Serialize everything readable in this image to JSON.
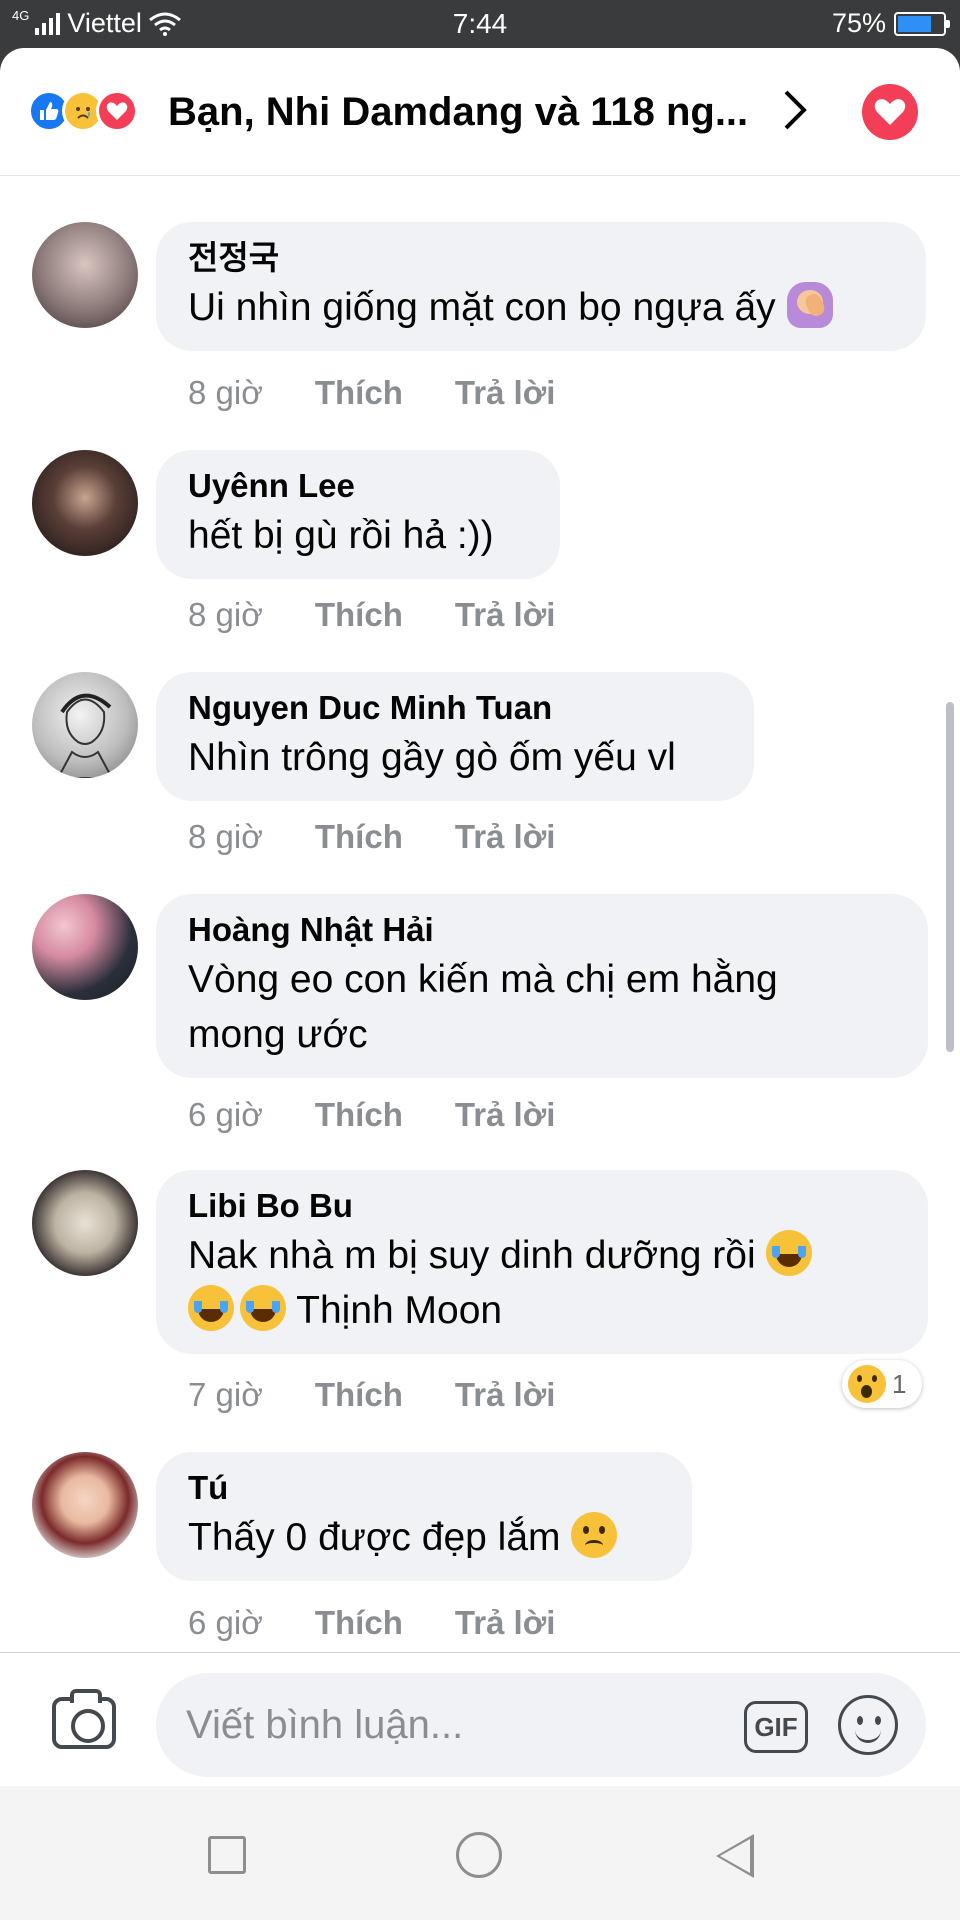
{
  "status_bar": {
    "network": "4G",
    "carrier": "Viettel",
    "time": "7:44",
    "battery_percent": "75%",
    "battery_level": 0.75
  },
  "header": {
    "reaction_icons": [
      "like-icon",
      "sad-icon",
      "love-icon"
    ],
    "title": "Bạn, Nhi Damdang và 118 ng...",
    "chevron": "›",
    "love_button_icon": "heart-icon"
  },
  "comments": [
    {
      "name": "전정국",
      "text": "Ui nhìn giống mặt con bọ ngựa ấy",
      "emoji": "facepalm",
      "time": "8 giờ",
      "like": "Thích",
      "reply": "Trả lời",
      "avatar_color": "#8c7a7a"
    },
    {
      "name": "Uyênn Lee",
      "text": "hết bị gù rồi hả :))",
      "time": "8 giờ",
      "like": "Thích",
      "reply": "Trả lời",
      "avatar_color": "#2b2424"
    },
    {
      "name": "Nguyen Duc Minh Tuan",
      "text": "Nhìn trông gầy gò ốm yếu vl",
      "time": "8 giờ",
      "like": "Thích",
      "reply": "Trả lời",
      "avatar_color": "#c8c8c8"
    },
    {
      "name": "Hoàng Nhật Hải",
      "text_line1": "Vòng eo con kiến mà chị em hằng",
      "text_line2": "mong ước",
      "time": "6 giờ",
      "like": "Thích",
      "reply": "Trả lời",
      "avatar_color": "#4a5a78"
    },
    {
      "name": "Libi Bo Bu",
      "text_line1": "Nak nhà m bị suy dinh dưỡng rồi",
      "mention": "Thịnh Moon",
      "time": "7 giờ",
      "like": "Thích",
      "reply": "Trả lời",
      "reaction_icon": "wow-icon",
      "reaction_count": "1",
      "avatar_color": "#3a3232"
    },
    {
      "name": "Tú",
      "text": "Thấy 0 được đẹp lắm",
      "time": "6 giờ",
      "like": "Thích",
      "reply": "Trả lời",
      "avatar_color": "#7a2a2a"
    }
  ],
  "composer": {
    "placeholder": "Viết bình luận...",
    "gif_label": "GIF",
    "camera_icon": "camera-icon",
    "emoji_icon": "smile-icon"
  },
  "nav": {
    "recent_icon": "square-icon",
    "home_icon": "circle-icon",
    "back_icon": "back-triangle-icon"
  }
}
